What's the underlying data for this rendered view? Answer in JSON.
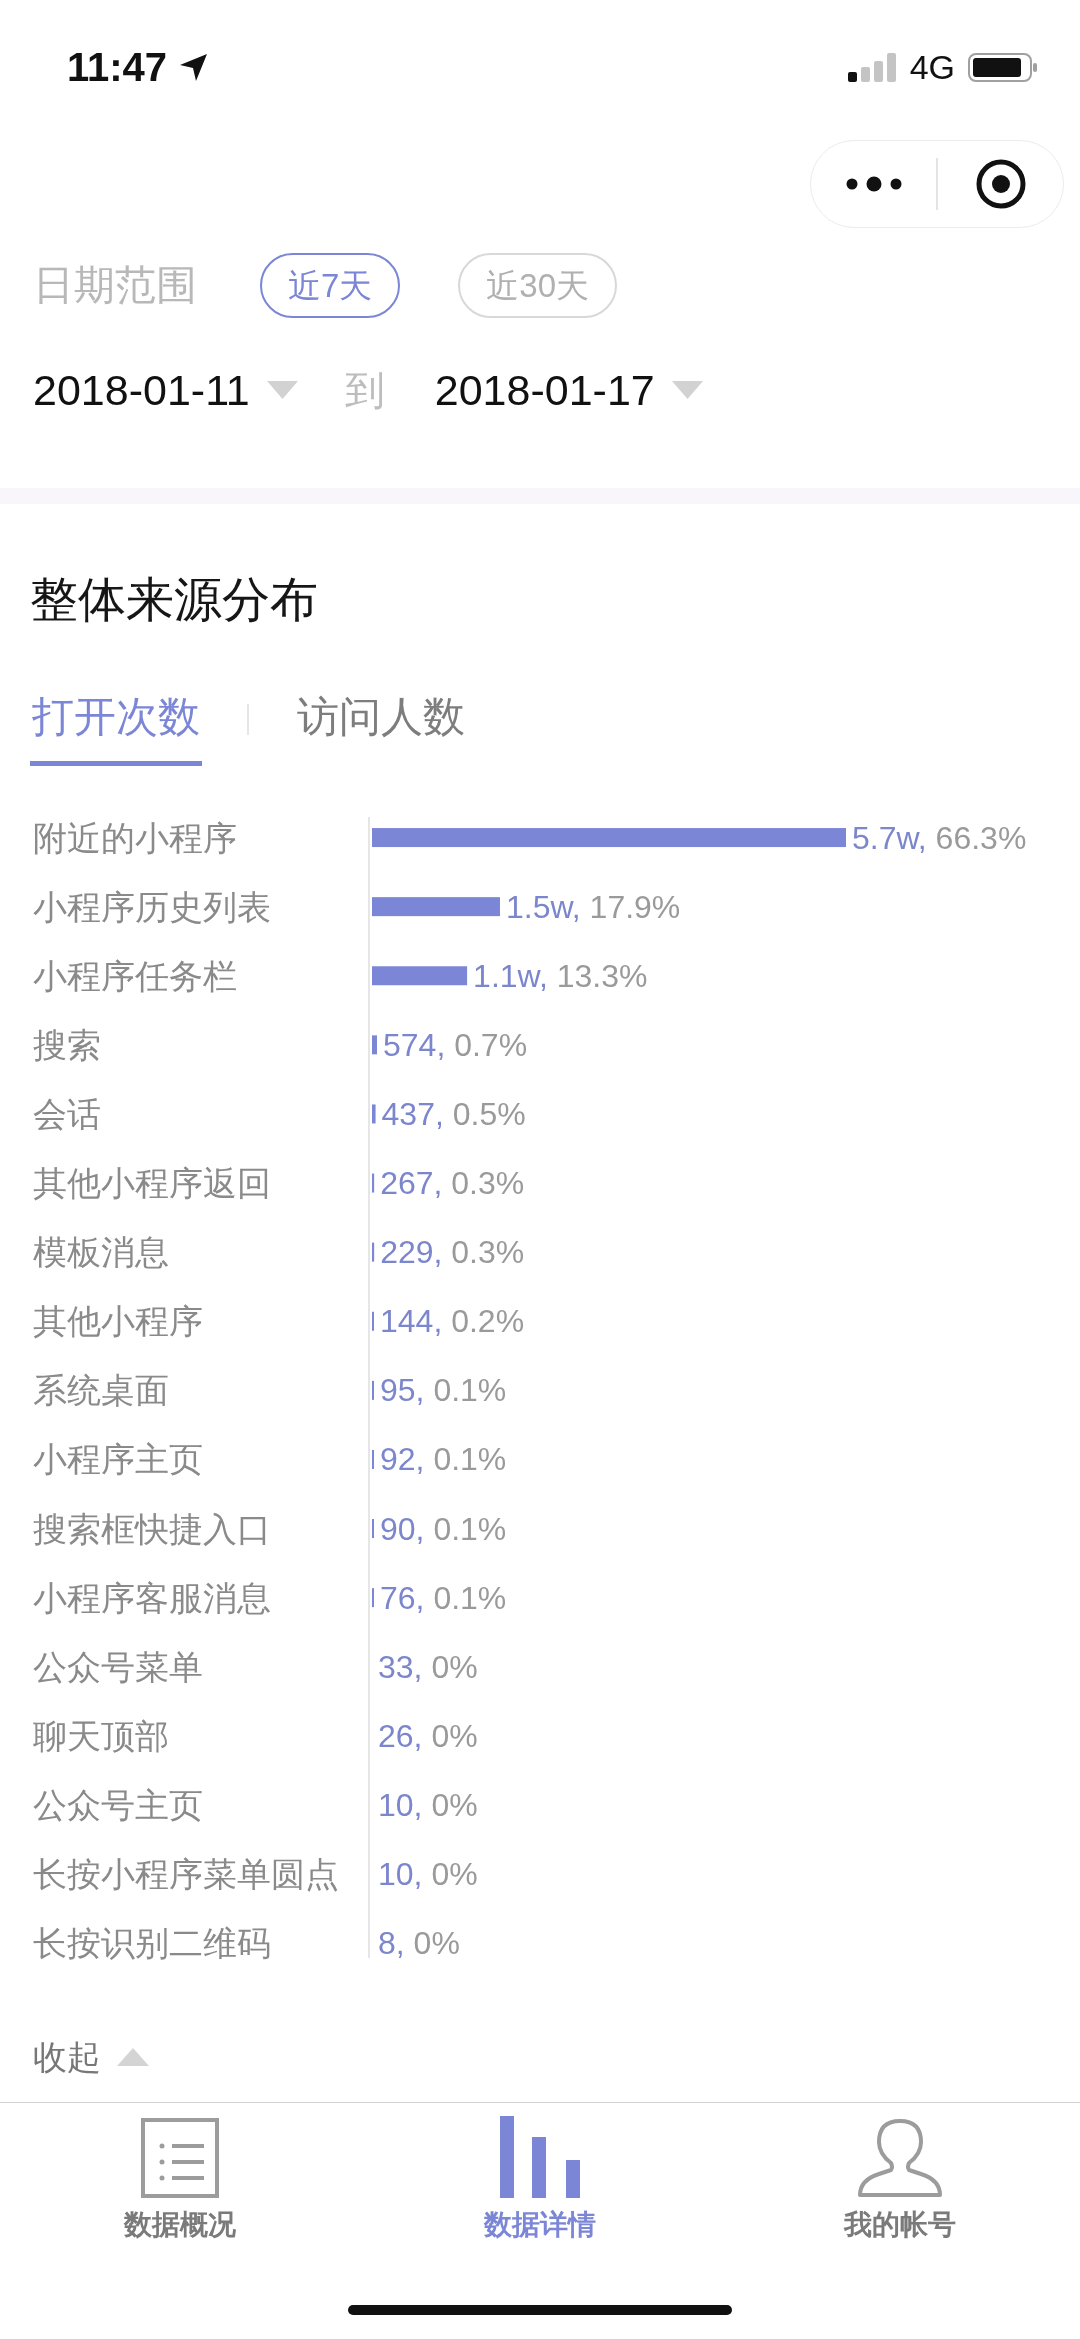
{
  "status_bar": {
    "time": "11:47",
    "network": "4G"
  },
  "date_range": {
    "label": "日期范围",
    "presets": [
      {
        "label": "近7天",
        "selected": true
      },
      {
        "label": "近30天",
        "selected": false
      }
    ],
    "start_date": "2018-01-11",
    "separator": "到",
    "end_date": "2018-01-17"
  },
  "source_distribution": {
    "title": "整体来源分布",
    "tabs": [
      {
        "label": "打开次数",
        "selected": true
      },
      {
        "label": "访问人数",
        "selected": false
      }
    ],
    "count_labels": [
      "5.7w,",
      "1.5w,",
      "1.1w,",
      "574,",
      "437,",
      "267,",
      "229,",
      "144,",
      "95,",
      "92,",
      "90,",
      "76,",
      "33,",
      "26,",
      "10,",
      "10,",
      "8,"
    ],
    "chart_data": {
      "type": "bar",
      "orientation": "horizontal",
      "categories": [
        "附近的小程序",
        "小程序历史列表",
        "小程序任务栏",
        "搜索",
        "会话",
        "其他小程序返回",
        "模板消息",
        "其他小程序",
        "系统桌面",
        "小程序主页",
        "搜索框快捷入口",
        "小程序客服消息",
        "公众号菜单",
        "聊天顶部",
        "公众号主页",
        "长按小程序菜单圆点",
        "长按识别二维码"
      ],
      "values": [
        66.3,
        17.9,
        13.3,
        0.7,
        0.5,
        0.3,
        0.3,
        0.2,
        0.1,
        0.1,
        0.1,
        0.1,
        0,
        0,
        0,
        0,
        0
      ],
      "value_labels": [
        "66.3%",
        "17.9%",
        "13.3%",
        "0.7%",
        "0.5%",
        "0.3%",
        "0.3%",
        "0.2%",
        "0.1%",
        "0.1%",
        "0.1%",
        "0.1%",
        "0%",
        "0%",
        "0%",
        "0%",
        "0%"
      ]
    },
    "collapse_label": "收起"
  },
  "bottom_tabs": [
    {
      "label": "数据概况",
      "selected": false
    },
    {
      "label": "数据详情",
      "selected": true
    },
    {
      "label": "我的帐号",
      "selected": false
    }
  ]
}
